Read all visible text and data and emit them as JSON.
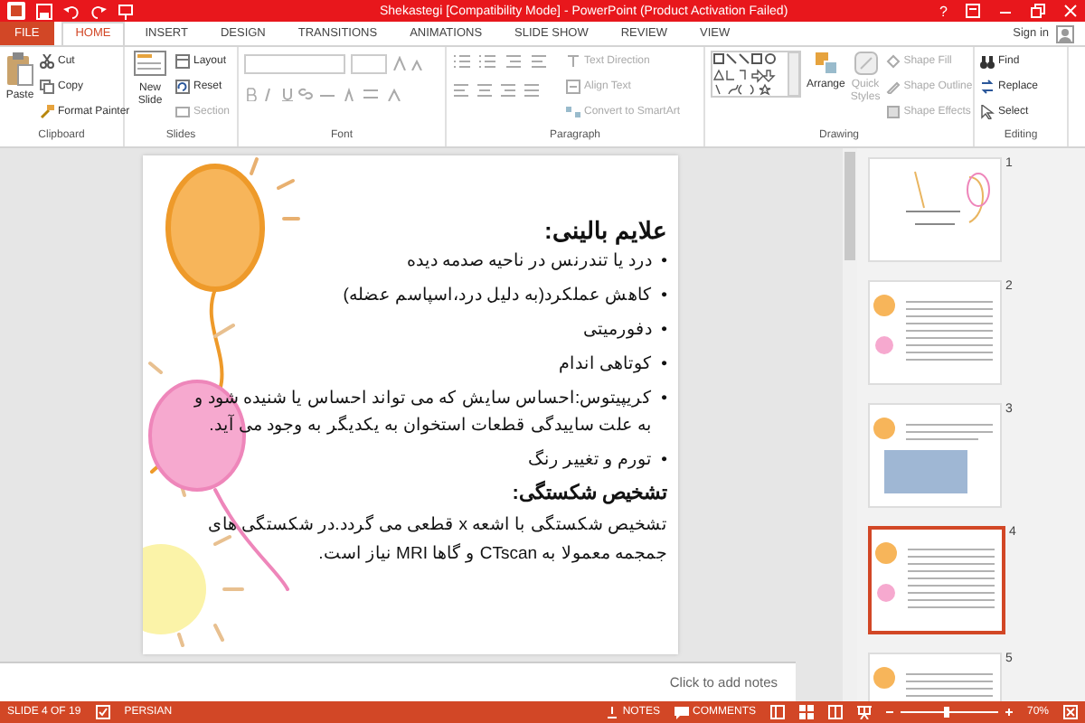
{
  "window": {
    "title": "Shekastegi [Compatibility Mode] - PowerPoint (Product Activation Failed)",
    "help": "?",
    "sign_in": "Sign in"
  },
  "tabs": [
    {
      "label": "FILE",
      "selected": false,
      "kind": "file"
    },
    {
      "label": "HOME",
      "selected": true,
      "kind": "tab"
    },
    {
      "label": "INSERT",
      "selected": false,
      "kind": "tab"
    },
    {
      "label": "DESIGN",
      "selected": false,
      "kind": "tab"
    },
    {
      "label": "TRANSITIONS",
      "selected": false,
      "kind": "tab"
    },
    {
      "label": "ANIMATIONS",
      "selected": false,
      "kind": "tab"
    },
    {
      "label": "SLIDE SHOW",
      "selected": false,
      "kind": "tab"
    },
    {
      "label": "REVIEW",
      "selected": false,
      "kind": "tab"
    },
    {
      "label": "VIEW",
      "selected": false,
      "kind": "tab"
    }
  ],
  "ribbon": {
    "clipboard": {
      "label": "Clipboard",
      "big": {
        "label": "Paste",
        "disabled": false
      },
      "items": [
        {
          "label": "Cut",
          "disabled": false
        },
        {
          "label": "Copy",
          "disabled": false
        },
        {
          "label": "Format Painter",
          "disabled": false
        }
      ]
    },
    "slides": {
      "label": "Slides",
      "big": {
        "label": "New Slide",
        "disabled": false
      },
      "items": [
        {
          "label": "Layout",
          "disabled": false
        },
        {
          "label": "Reset",
          "disabled": false
        },
        {
          "label": "Section",
          "disabled": true
        }
      ]
    },
    "font": {
      "label": "Font"
    },
    "paragraph": {
      "label": "Paragraph",
      "items": [
        {
          "label": "Text Direction",
          "disabled": true
        },
        {
          "label": "Align Text",
          "disabled": true
        },
        {
          "label": "Convert to SmartArt",
          "disabled": true
        }
      ]
    },
    "drawing": {
      "label": "Drawing",
      "arrange": "Arrange",
      "quick_styles": "Quick Styles",
      "items": [
        {
          "label": "Shape Fill",
          "disabled": true
        },
        {
          "label": "Shape Outline",
          "disabled": true
        },
        {
          "label": "Shape Effects",
          "disabled": true
        }
      ]
    },
    "editing": {
      "label": "Editing",
      "items": [
        {
          "label": "Find",
          "disabled": false
        },
        {
          "label": "Replace",
          "disabled": false
        },
        {
          "label": "Select",
          "disabled": false
        }
      ]
    }
  },
  "slide": {
    "heading": "علایم بالینی:",
    "bullet_mark": "•",
    "bullets": [
      "درد یا تندرنس در ناحیه صدمه دیده",
      "کاهش عملکرد(به دلیل درد،اسپاسم عضله)",
      "دفورمیتی",
      "کوتاهی اندام",
      "کریپیتوس:احساس سایش که می تواند احساس یا شنیده شود و به علت ساییدگی قطعات استخوان به یکدیگر به وجود می آید.",
      "تورم و تغییر رنگ"
    ],
    "subheading": "تشخیص شکستگی:",
    "paragraph": "تشخیص شکستگی با اشعه x قطعی می گردد.در شکستگی های جمجمه معمولا به  CTscan  و گاها  MRI  نیاز است."
  },
  "notes": {
    "placeholder": "Click to add notes"
  },
  "thumbnails": [
    {
      "number": "1",
      "selected": false
    },
    {
      "number": "2",
      "selected": false
    },
    {
      "number": "3",
      "selected": false
    },
    {
      "number": "4",
      "selected": true
    },
    {
      "number": "5",
      "selected": false
    }
  ],
  "status_bar": {
    "slide": "SLIDE 4 OF 19",
    "language": "PERSIAN",
    "notes": "NOTES",
    "comments": "COMMENTS",
    "zoom": "70%"
  }
}
